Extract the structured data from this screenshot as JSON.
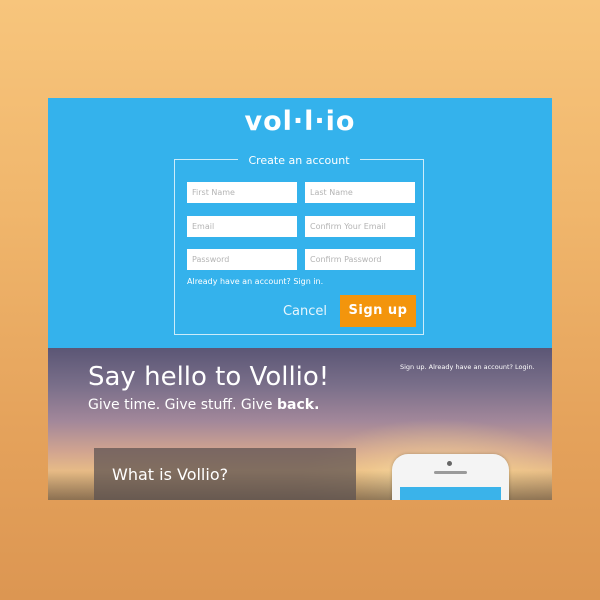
{
  "logo": {
    "text": "vol·l·io"
  },
  "signup_form": {
    "legend": "Create an account",
    "fields": {
      "first_name": {
        "placeholder": "First Name",
        "value": ""
      },
      "last_name": {
        "placeholder": "Last Name",
        "value": ""
      },
      "email": {
        "placeholder": "Email",
        "value": ""
      },
      "confirm_email": {
        "placeholder": "Confirm Your Email",
        "value": ""
      },
      "password": {
        "placeholder": "Password",
        "value": ""
      },
      "confirm_password": {
        "placeholder": "Confirm Password",
        "value": ""
      }
    },
    "signin_link": "Already have an account? Sign in.",
    "cancel_label": "Cancel",
    "signup_label": "Sign up"
  },
  "hero": {
    "title": "Say hello to Vollio!",
    "subtitle_main": "Give time. Give stuff. Give ",
    "subtitle_bold": "back.",
    "top_links": {
      "signup": "Sign up.",
      "login": "Already have an account? Login."
    },
    "info_title": "What is Vollio?"
  },
  "colors": {
    "page_background": "#f0b66c",
    "panel_blue": "#34b2ec",
    "signup_orange": "#f3950c",
    "text_white": "#ffffff"
  },
  "icons": {
    "phone": "smartphone-illustration"
  }
}
